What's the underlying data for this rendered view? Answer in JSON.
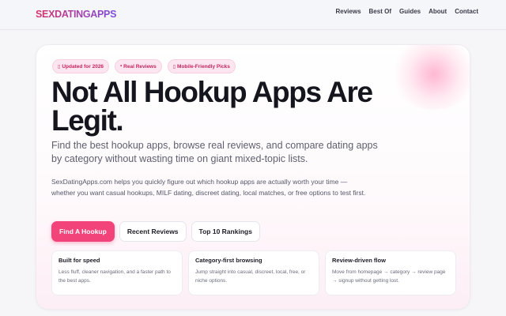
{
  "header": {
    "logo": "SEXDATINGAPPS",
    "nav": [
      "Reviews",
      "Best Of",
      "Guides",
      "About",
      "Contact"
    ]
  },
  "hero": {
    "badges": [
      {
        "icon": "calendar-icon",
        "glyph": "▯",
        "label": "Updated for 2026"
      },
      {
        "icon": "star-icon",
        "glyph": "•",
        "label": "Real Reviews"
      },
      {
        "icon": "phone-icon",
        "glyph": "▯",
        "label": "Mobile-Friendly Picks"
      }
    ],
    "title": "Not All Hookup Apps Are Legit.",
    "subtitle": "Find the best hookup apps, browse real reviews, and compare dating apps by category without wasting time on giant mixed-topic lists.",
    "description": "SexDatingApps.com helps you quickly figure out which hookup apps are actually worth your time — whether you want casual hookups, MILF dating, discreet dating, local matches, or free options to test first.",
    "ctas": {
      "primary": "Find A Hookup",
      "secondary": "Recent Reviews",
      "tertiary": "Top 10 Rankings"
    },
    "features": [
      {
        "title": "Built for speed",
        "text": "Less fluff, cleaner navigation, and a faster path to the best apps."
      },
      {
        "title": "Category-first browsing",
        "text": "Jump straight into casual, discreet, local, free, or niche options."
      },
      {
        "title": "Review-driven flow",
        "text": "Move from homepage → category → review page → signup without getting lost."
      }
    ]
  },
  "colors": {
    "accent": "#f2437a",
    "badge_bg": "#fde6ef",
    "badge_text": "#c2255c",
    "logo_gradient_start": "#d6336c",
    "logo_gradient_end": "#7c4ddc"
  }
}
